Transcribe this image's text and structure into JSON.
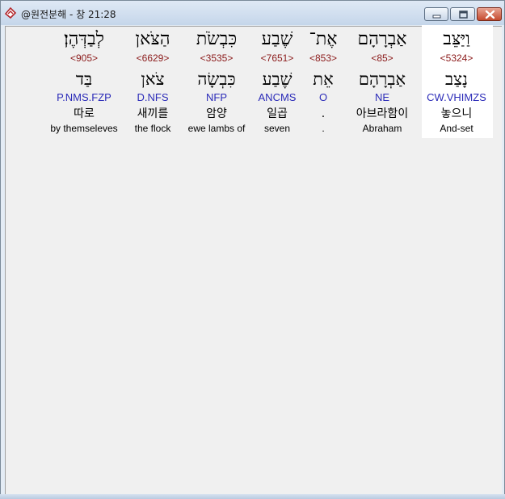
{
  "window": {
    "title": "@원전분해 - 창 21:28",
    "icon": "app-logo-icon",
    "controls": [
      "minimize-icon",
      "maximize-icon",
      "close-icon"
    ]
  },
  "words": [
    {
      "hebrew": "וַיַּצֵּב",
      "strong": "<5324>",
      "lemma": "נָצַב",
      "parse": "CW.VHIMZS",
      "korean": "놓으니",
      "english": "And-set",
      "selected": true
    },
    {
      "hebrew": "אַבְרָהָם",
      "strong": "<85>",
      "lemma": "אַבְרָהָם",
      "parse": "NE",
      "korean": "아브라함이",
      "english": "Abraham",
      "selected": false
    },
    {
      "hebrew": "אֶת־",
      "strong": "<853>",
      "lemma": "אֵת",
      "parse": "O",
      "korean": ".",
      "english": ".",
      "selected": false
    },
    {
      "hebrew": "שֶׁבַע",
      "strong": "<7651>",
      "lemma": "שֶׁבַע",
      "parse": "ANCMS",
      "korean": "일곱",
      "english": "seven",
      "selected": false
    },
    {
      "hebrew": "כִּבְשֹׂת",
      "strong": "<3535>",
      "lemma": "כִּבְשָׂה",
      "parse": "NFP",
      "korean": "암양",
      "english": "ewe lambs of",
      "selected": false
    },
    {
      "hebrew": "הַצֹּאן",
      "strong": "<6629>",
      "lemma": "צֹאן",
      "parse": "D.NFS",
      "korean": "새끼를",
      "english": "the flock",
      "selected": false
    },
    {
      "hebrew": "לְבַדְּהֶן׃",
      "strong": "<905>",
      "lemma": "בַּד",
      "parse": "P.NMS.FZP",
      "korean": "따로",
      "english": "by themseleves",
      "selected": false
    }
  ]
}
